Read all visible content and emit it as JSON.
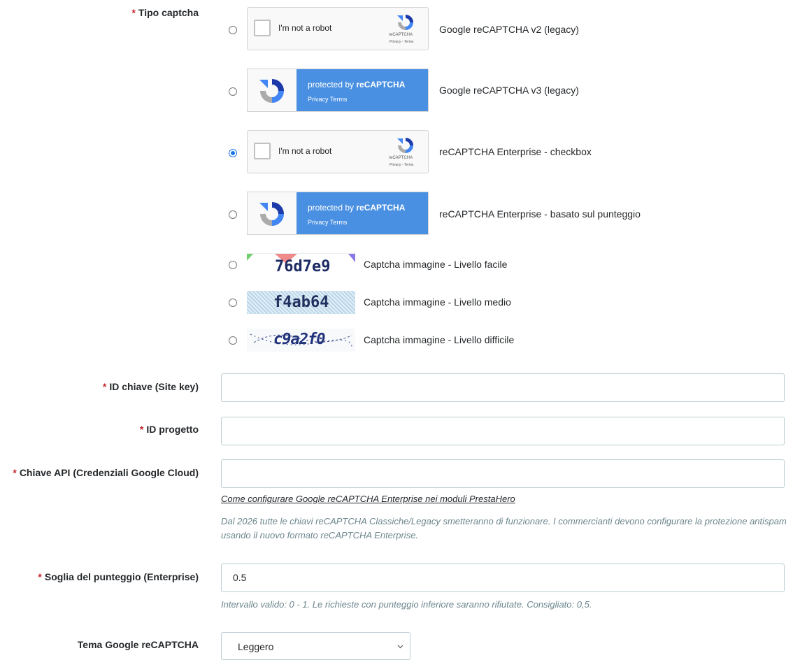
{
  "captcha_type": {
    "label": "Tipo captcha",
    "options": [
      {
        "label": "Google reCAPTCHA v2 (legacy)",
        "widget": "checkbox",
        "checked": false
      },
      {
        "label": "Google reCAPTCHA v3 (legacy)",
        "widget": "badge",
        "checked": false
      },
      {
        "label": "reCAPTCHA Enterprise - checkbox",
        "widget": "checkbox",
        "checked": true
      },
      {
        "label": "reCAPTCHA Enterprise - basato sul punteggio",
        "widget": "badge",
        "checked": false
      },
      {
        "label": "Captcha immagine - Livello facile",
        "widget": "image",
        "image_text": "76d7e9",
        "checked": false
      },
      {
        "label": "Captcha immagine - Livello medio",
        "widget": "image",
        "image_text": "f4ab64",
        "checked": false
      },
      {
        "label": "Captcha immagine - Livello difficile",
        "widget": "image",
        "image_text": "c9a2f0",
        "checked": false
      }
    ],
    "checkbox_widget": {
      "text": "I'm not a robot",
      "brand": "reCAPTCHA",
      "terms": "Privacy - Terms"
    },
    "badge_widget": {
      "text_prefix": "protected by ",
      "text_brand": "reCAPTCHA",
      "links": "Privacy  Terms"
    }
  },
  "site_key": {
    "label": "ID chiave (Site key)",
    "value": ""
  },
  "project_id": {
    "label": "ID progetto",
    "value": ""
  },
  "api_key": {
    "label": "Chiave API (Credenziali Google Cloud)",
    "value": "",
    "help_link": "Come configurare Google reCAPTCHA Enterprise nei moduli PrestaHero",
    "help_text": "Dal 2026 tutte le chiavi reCAPTCHA Classiche/Legacy smetteranno di funzionare. I commercianti devono configurare la protezione antispam usando il nuovo formato reCAPTCHA Enterprise."
  },
  "score_threshold": {
    "label": "Soglia del punteggio (Enterprise)",
    "value": "0.5",
    "help_text": "Intervallo valido: 0 - 1. Le richieste con punteggio inferiore saranno rifiutate. Consigliato: 0,5."
  },
  "theme": {
    "label": "Tema Google reCAPTCHA",
    "selected": "Leggero"
  },
  "required_marker": "*",
  "colors": {
    "accent": "#1a73e8",
    "required": "#c6262e",
    "badge_blue": "#4a90e2",
    "border": "#bbcdd2"
  }
}
